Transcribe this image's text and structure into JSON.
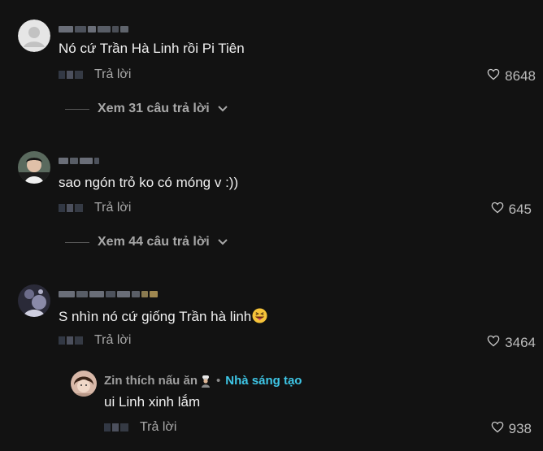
{
  "comments": [
    {
      "text": "Nó cứ Trần Hà Linh rồi Pi Tiên",
      "reply_label": "Trả lời",
      "likes": "8648",
      "view_replies": "Xem 31 câu trả lời"
    },
    {
      "text": "sao ngón trỏ ko có móng v :))",
      "reply_label": "Trả lời",
      "likes": "645",
      "view_replies": "Xem 44 câu trả lời"
    },
    {
      "text": "S nhìn nó cứ giống Trần hà linh",
      "emoji": "grinning-squinting-face-with-tongue",
      "reply_label": "Trả lời",
      "likes": "3464",
      "reply": {
        "author": "Zin thích nấu ăn",
        "author_icon": "chef-icon",
        "separator": "•",
        "badge": "Nhà sáng tạo",
        "text": "ui Linh xinh lắm",
        "reply_label": "Trả lời",
        "likes": "938"
      }
    }
  ],
  "colors": {
    "background": "#121212",
    "text": "#f0f0f0",
    "secondary": "#a8a8a8",
    "creator_badge": "#3ec6e6"
  }
}
